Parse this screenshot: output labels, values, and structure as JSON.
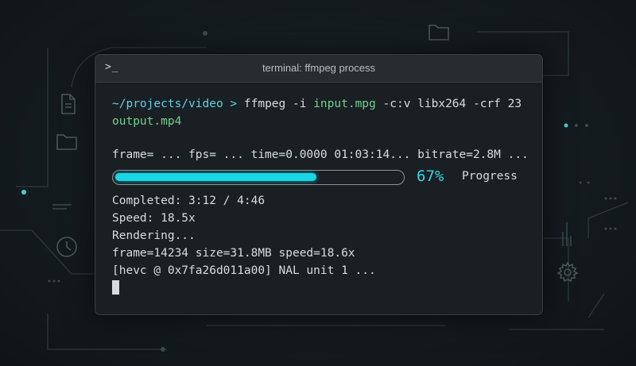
{
  "window": {
    "title": "terminal: ffmpeg process",
    "prompt_glyph": ">_"
  },
  "command": {
    "path": "~/projects/video >",
    "cmd": "ffmpeg -i",
    "input": "input.mpg",
    "args": "-c:v libx264 -crf 23",
    "output": "output.mp4"
  },
  "status_line": "frame= ... fps= ... time=0.0000 01:03:14... bitrate=2.8M ...",
  "progress": {
    "percent": 67,
    "percent_text": "67%",
    "label": "Progress"
  },
  "lines": {
    "completed": "Completed: 3:12 / 4:46",
    "speed": "Speed: 18.5x",
    "rendering": "Rendering...",
    "frame_info": "frame=14234 size=31.8MB speed=18.6x",
    "hevc": "[hevc @ 0x7fa26d011a00] NAL unit 1 ..."
  },
  "colors": {
    "accent": "#19d6e6",
    "path": "#5ad2e8",
    "filename": "#6ed38a",
    "background": "#141b1f"
  },
  "icons": [
    "document-icon",
    "folder-icon",
    "clock-icon",
    "gear-icon",
    "folder-icon",
    "terminal-prompt-icon"
  ]
}
